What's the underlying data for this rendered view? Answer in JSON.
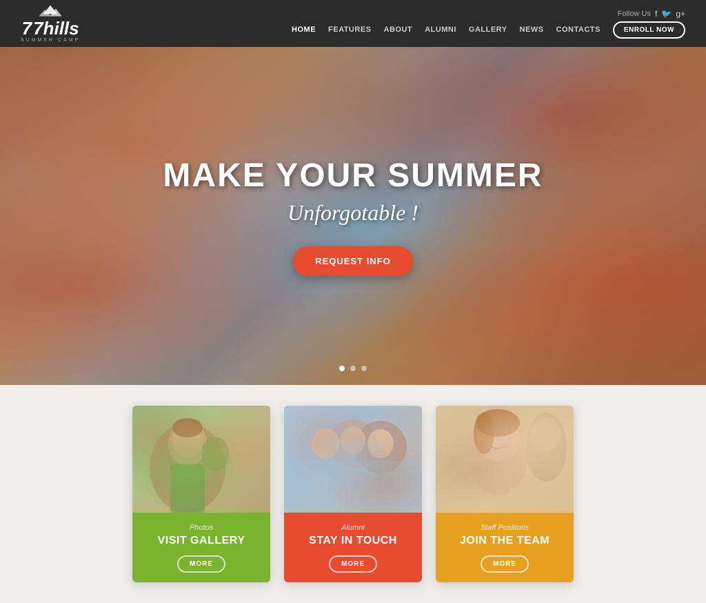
{
  "header": {
    "logo": {
      "name": "7hills",
      "tagline": "SUMMER CAMP"
    },
    "follow_us_label": "Follow Us",
    "social_icons": [
      "f",
      "t",
      "g+"
    ],
    "nav_items": [
      {
        "label": "HOME",
        "active": true
      },
      {
        "label": "FEATURES",
        "active": false
      },
      {
        "label": "ABOUT",
        "active": false
      },
      {
        "label": "ALUMNI",
        "active": false
      },
      {
        "label": "GALLERY",
        "active": false
      },
      {
        "label": "NEWS",
        "active": false
      },
      {
        "label": "CONTACTS",
        "active": false
      }
    ],
    "enroll_button": "ENROLL NOW"
  },
  "hero": {
    "title": "MAKE YOUR SUMMER",
    "subtitle": "Unforgotable !",
    "cta_button": "REQUEST INFO",
    "dots": [
      {
        "active": true
      },
      {
        "active": false
      },
      {
        "active": false
      }
    ]
  },
  "cards": [
    {
      "category": "Photos",
      "title": "VISIT GALLERY",
      "more_label": "MORE",
      "color": "green"
    },
    {
      "category": "Alumni",
      "title": "STAY IN TOUCH",
      "more_label": "MORE",
      "color": "red"
    },
    {
      "category": "Staff Positions",
      "title": "JOIN THE TEAM",
      "more_label": "MORE",
      "color": "yellow"
    }
  ]
}
